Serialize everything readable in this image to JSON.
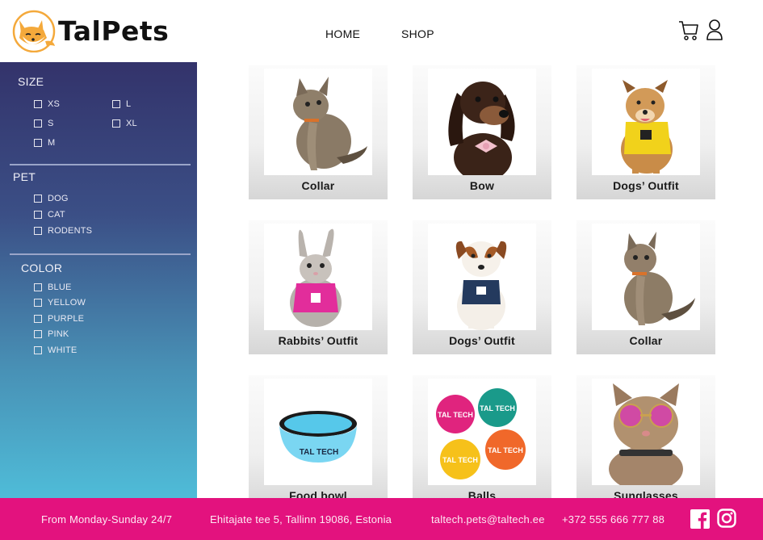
{
  "header": {
    "brand": "TalPets",
    "nav": {
      "home": "HOME",
      "shop": "SHOP"
    }
  },
  "icons": {
    "logo": "fox-logo-icon",
    "cart": "cart-icon",
    "user": "user-icon",
    "facebook": "facebook-icon",
    "instagram": "instagram-icon"
  },
  "filters": {
    "size": {
      "title": "SIZE",
      "options": [
        "XS",
        "L",
        "S",
        "XL",
        "M"
      ]
    },
    "pet": {
      "title": "PET",
      "options": [
        "DOG",
        "CAT",
        "RODENTS"
      ]
    },
    "color": {
      "title": "COLOR",
      "options": [
        "BLUE",
        "YELLOW",
        "PURPLE",
        "PINK",
        "WHITE"
      ]
    }
  },
  "products": [
    {
      "name": "Collar"
    },
    {
      "name": "Bow"
    },
    {
      "name": "Dogs’ Outfit"
    },
    {
      "name": "Rabbits’ Outfit"
    },
    {
      "name": "Dogs’ Outfit"
    },
    {
      "name": "Collar"
    },
    {
      "name": "Food bowl"
    },
    {
      "name": "Balls"
    },
    {
      "name": "Sunglasses"
    }
  ],
  "footer": {
    "hours": "From Monday-Sunday 24/7",
    "address": "Ehitajate tee 5, Tallinn 19086, Estonia",
    "email": "taltech.pets@taltech.ee",
    "phone": "+372 555 666 777 88"
  },
  "ball_text": "TAL TECH",
  "bowl_text": "TAL TECH",
  "colors": {
    "footer": "#e3127e",
    "sidebar_top": "#33336b",
    "sidebar_bottom": "#4fbcd8",
    "logo_orange": "#f4a93b"
  }
}
